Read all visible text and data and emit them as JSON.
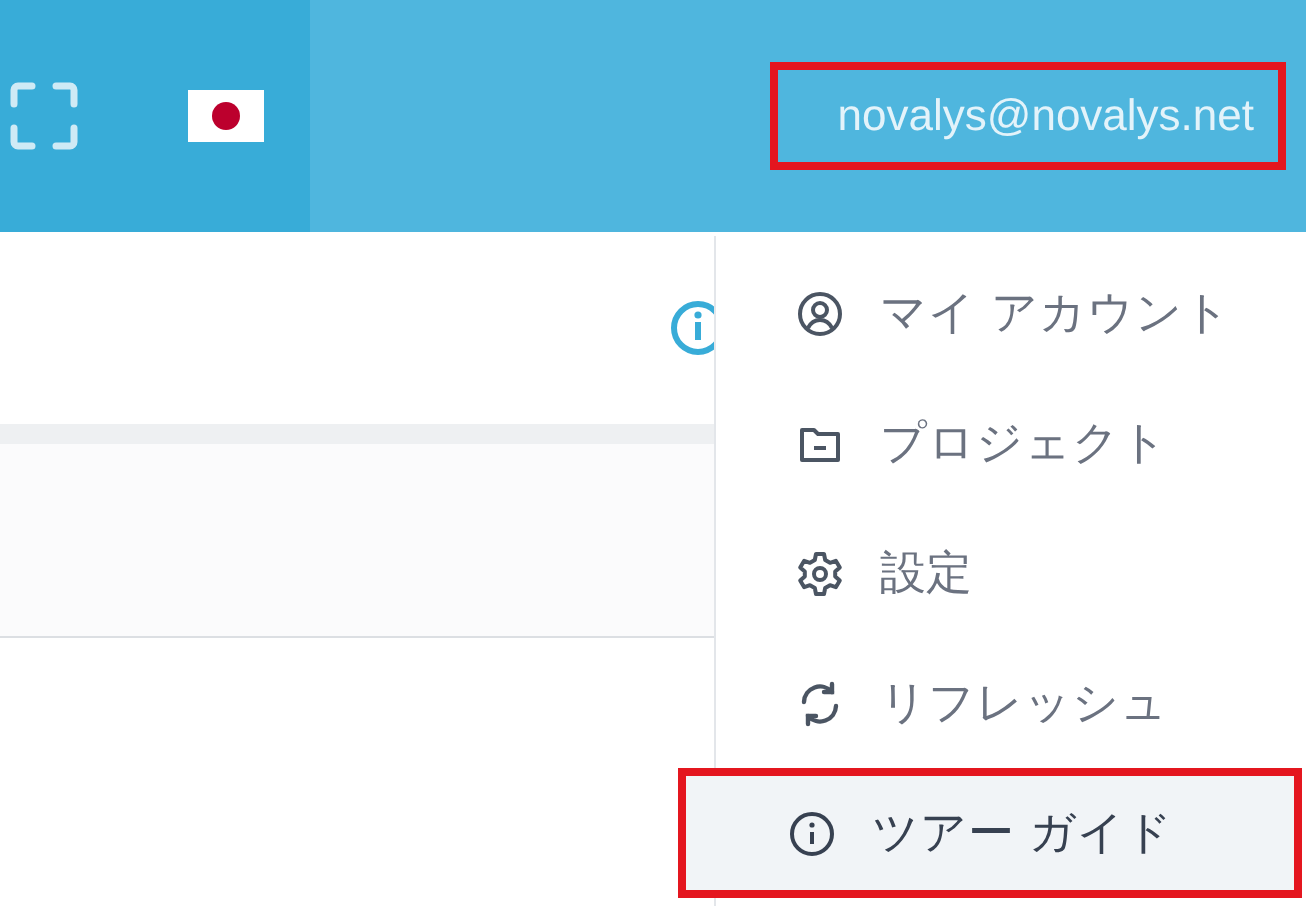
{
  "header": {
    "flag": {
      "kind": "japan"
    },
    "user": {
      "email": "novalys@novalys.net",
      "annotated": true
    }
  },
  "user_menu": {
    "items": [
      {
        "kind": "account",
        "label": "マイ アカウント",
        "selected": false,
        "annotated": false
      },
      {
        "kind": "project",
        "label": "プロジェクト",
        "selected": false,
        "annotated": false
      },
      {
        "kind": "settings",
        "label": "設定",
        "selected": false,
        "annotated": false
      },
      {
        "kind": "refresh",
        "label": "リフレッシュ",
        "selected": false,
        "annotated": false
      },
      {
        "kind": "tour",
        "label": "ツアー ガイド",
        "selected": true,
        "annotated": true
      }
    ]
  }
}
